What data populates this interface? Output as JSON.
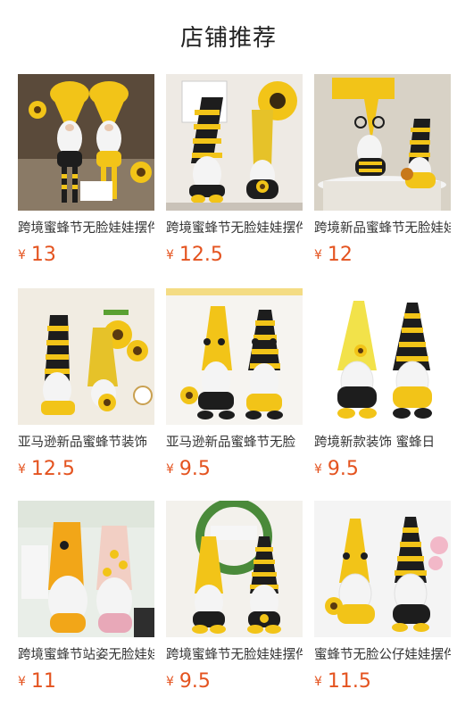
{
  "header": {
    "title": "店铺推荐"
  },
  "currency_symbol": "¥",
  "colors": {
    "price": "#e4531f",
    "bee_yellow": "#f2c418",
    "stripe_black": "#1d1d1d",
    "beard_white": "#f4f4f4"
  },
  "products": [
    {
      "title": "跨境蜜蜂节无脸娃娃摆件",
      "price": "13",
      "image": "bee-gnome-pair-hanging-legs-photo"
    },
    {
      "title": "跨境蜜蜂节无脸娃娃摆件",
      "price": "12.5",
      "image": "bee-gnome-pair-sunflower-photo"
    },
    {
      "title": "跨境新品蜜蜂节无脸娃娃",
      "price": "12",
      "image": "bee-gnome-pair-honey-pot-photo"
    },
    {
      "title": "亚马逊新品蜜蜂节装饰",
      "price": "12.5",
      "image": "bee-gnome-pair-sunflower-vase-photo"
    },
    {
      "title": "亚马逊新品蜜蜂节无脸",
      "price": "9.5",
      "image": "bee-gnome-pair-antennae-photo"
    },
    {
      "title": "跨境新款装饰 蜜蜂日",
      "price": "9.5",
      "image": "bee-gnome-pair-white-bg-photo"
    },
    {
      "title": "跨境蜜蜂节站姿无脸娃娃",
      "price": "11",
      "image": "bee-gnome-pair-plush-pastel-photo"
    },
    {
      "title": "跨境蜜蜂节无脸娃娃摆件",
      "price": "9.5",
      "image": "bee-gnome-pair-wreath-photo"
    },
    {
      "title": "蜜蜂节无脸公仔娃娃摆件",
      "price": "11.5",
      "image": "bee-gnome-pair-flowers-photo"
    }
  ]
}
